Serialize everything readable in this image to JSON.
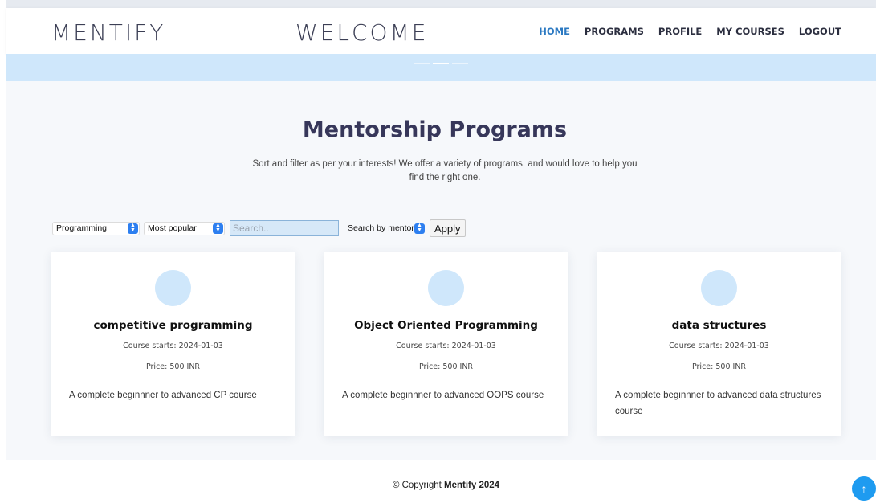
{
  "header": {
    "brand": "MENTIFY",
    "welcome": "WELCOME",
    "nav": [
      "HOME",
      "PROGRAMS",
      "PROFILE",
      "MY COURSES",
      "LOGOUT"
    ],
    "active_nav": "HOME"
  },
  "main": {
    "title": "Mentorship Programs",
    "subtitle": "Sort and filter as per your interests! We offer a variety of programs, and would love to help you find the right one."
  },
  "filters": {
    "category": "Programming",
    "sort": "Most popular",
    "search_placeholder": "Search..",
    "search_mode": "Search by mentor",
    "apply_label": "Apply"
  },
  "cards": [
    {
      "title": "competitive programming",
      "starts": "Course starts: 2024-01-03",
      "price": "Price: 500 INR",
      "description": "A complete beginnner to advanced CP course"
    },
    {
      "title": "Object Oriented Programming",
      "starts": "Course starts: 2024-01-03",
      "price": "Price: 500 INR",
      "description": "A complete beginnner to advanced OOPS course"
    },
    {
      "title": "data structures",
      "starts": "Course starts: 2024-01-03",
      "price": "Price: 500 INR",
      "description": "A complete beginnner to advanced data structures course"
    }
  ],
  "footer": {
    "prefix": "© Copyright",
    "brand": "Mentify 2024"
  },
  "colors": {
    "accent": "#2b79c2",
    "hero": "#cfe7fb",
    "scroll_top": "#1e9bf0"
  },
  "icons": {
    "scroll_top": "arrow-up-icon",
    "select_arrow": "chevron-updown-icon"
  }
}
